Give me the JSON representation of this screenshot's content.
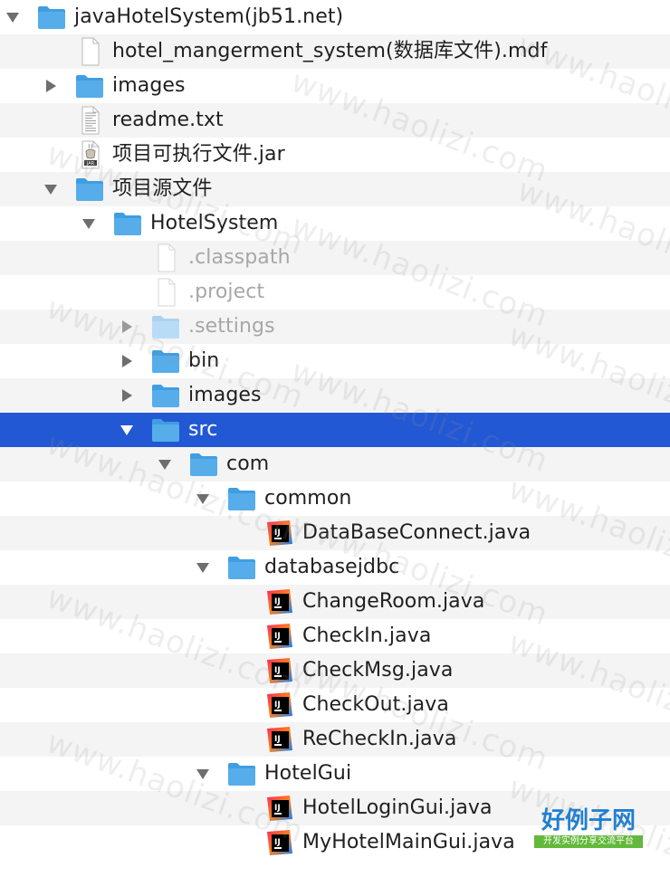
{
  "colors": {
    "selection": "#2358d4",
    "folder": "#56adea",
    "folder_dim": "#b9dcf6",
    "stripe": "#f4f4f5",
    "text": "#1f1f1f",
    "text_dim": "#a7a7a7"
  },
  "tree": [
    {
      "label": "javaHotelSystem(jb51.net)",
      "depth": 0,
      "type": "folder",
      "disclosure": "expanded"
    },
    {
      "label": "hotel_mangerment_system(数据库文件).mdf",
      "depth": 1,
      "type": "file",
      "disclosure": "none"
    },
    {
      "label": "images",
      "depth": 1,
      "type": "folder",
      "disclosure": "collapsed"
    },
    {
      "label": "readme.txt",
      "depth": 1,
      "type": "text",
      "disclosure": "none"
    },
    {
      "label": "项目可执行文件.jar",
      "depth": 1,
      "type": "jar",
      "disclosure": "none"
    },
    {
      "label": "项目源文件",
      "depth": 1,
      "type": "folder",
      "disclosure": "expanded"
    },
    {
      "label": "HotelSystem",
      "depth": 2,
      "type": "folder",
      "disclosure": "expanded"
    },
    {
      "label": ".classpath",
      "depth": 3,
      "type": "file",
      "disclosure": "none",
      "dim": true
    },
    {
      "label": ".project",
      "depth": 3,
      "type": "file",
      "disclosure": "none",
      "dim": true
    },
    {
      "label": ".settings",
      "depth": 3,
      "type": "folder",
      "disclosure": "collapsed",
      "dim": true
    },
    {
      "label": "bin",
      "depth": 3,
      "type": "folder",
      "disclosure": "collapsed"
    },
    {
      "label": "images",
      "depth": 3,
      "type": "folder",
      "disclosure": "collapsed"
    },
    {
      "label": "src",
      "depth": 3,
      "type": "folder",
      "disclosure": "expanded",
      "selected": true
    },
    {
      "label": "com",
      "depth": 4,
      "type": "folder",
      "disclosure": "expanded"
    },
    {
      "label": "common",
      "depth": 5,
      "type": "folder",
      "disclosure": "expanded"
    },
    {
      "label": "DataBaseConnect.java",
      "depth": 6,
      "type": "java",
      "disclosure": "none"
    },
    {
      "label": "databasejdbc",
      "depth": 5,
      "type": "folder",
      "disclosure": "expanded"
    },
    {
      "label": "ChangeRoom.java",
      "depth": 6,
      "type": "java",
      "disclosure": "none"
    },
    {
      "label": "CheckIn.java",
      "depth": 6,
      "type": "java",
      "disclosure": "none"
    },
    {
      "label": "CheckMsg.java",
      "depth": 6,
      "type": "java",
      "disclosure": "none"
    },
    {
      "label": "CheckOut.java",
      "depth": 6,
      "type": "java",
      "disclosure": "none"
    },
    {
      "label": "ReCheckIn.java",
      "depth": 6,
      "type": "java",
      "disclosure": "none"
    },
    {
      "label": "HotelGui",
      "depth": 5,
      "type": "folder",
      "disclosure": "expanded"
    },
    {
      "label": "HotelLoginGui.java",
      "depth": 6,
      "type": "java",
      "disclosure": "none"
    },
    {
      "label": "MyHotelMainGui.java",
      "depth": 6,
      "type": "java",
      "disclosure": "none"
    }
  ],
  "watermark": "www.haolizi.com",
  "logo": {
    "title": "好例子网",
    "subtitle": "开发实例分享交流平台"
  }
}
